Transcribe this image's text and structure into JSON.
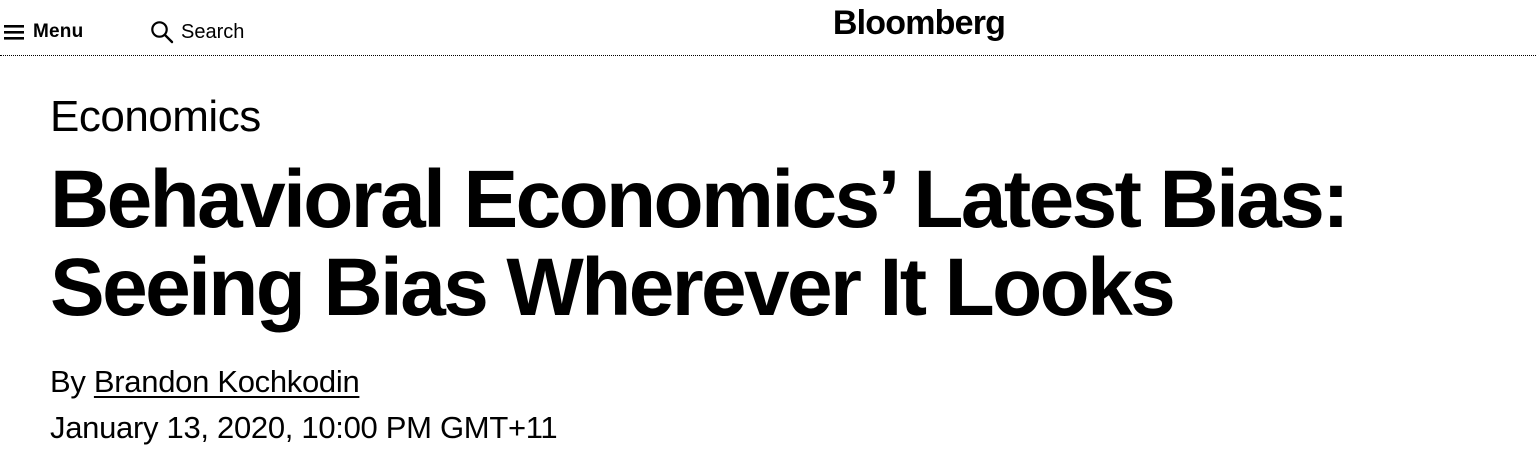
{
  "nav": {
    "menu_label": "Menu",
    "search_label": "Search",
    "brand": "Bloomberg"
  },
  "article": {
    "category": "Economics",
    "headline_line1": "Behavioral Economics’ Latest Bias:",
    "headline_line2": "Seeing Bias Wherever It Looks",
    "byline_prefix": "By",
    "author": "Brandon Kochkodin",
    "published": "January 13, 2020, 10:00 PM GMT+11"
  },
  "icons": {
    "menu": "hamburger-menu-icon",
    "search": "magnifying-glass-search-icon"
  },
  "colors": {
    "text": "#000000",
    "background": "#ffffff"
  }
}
